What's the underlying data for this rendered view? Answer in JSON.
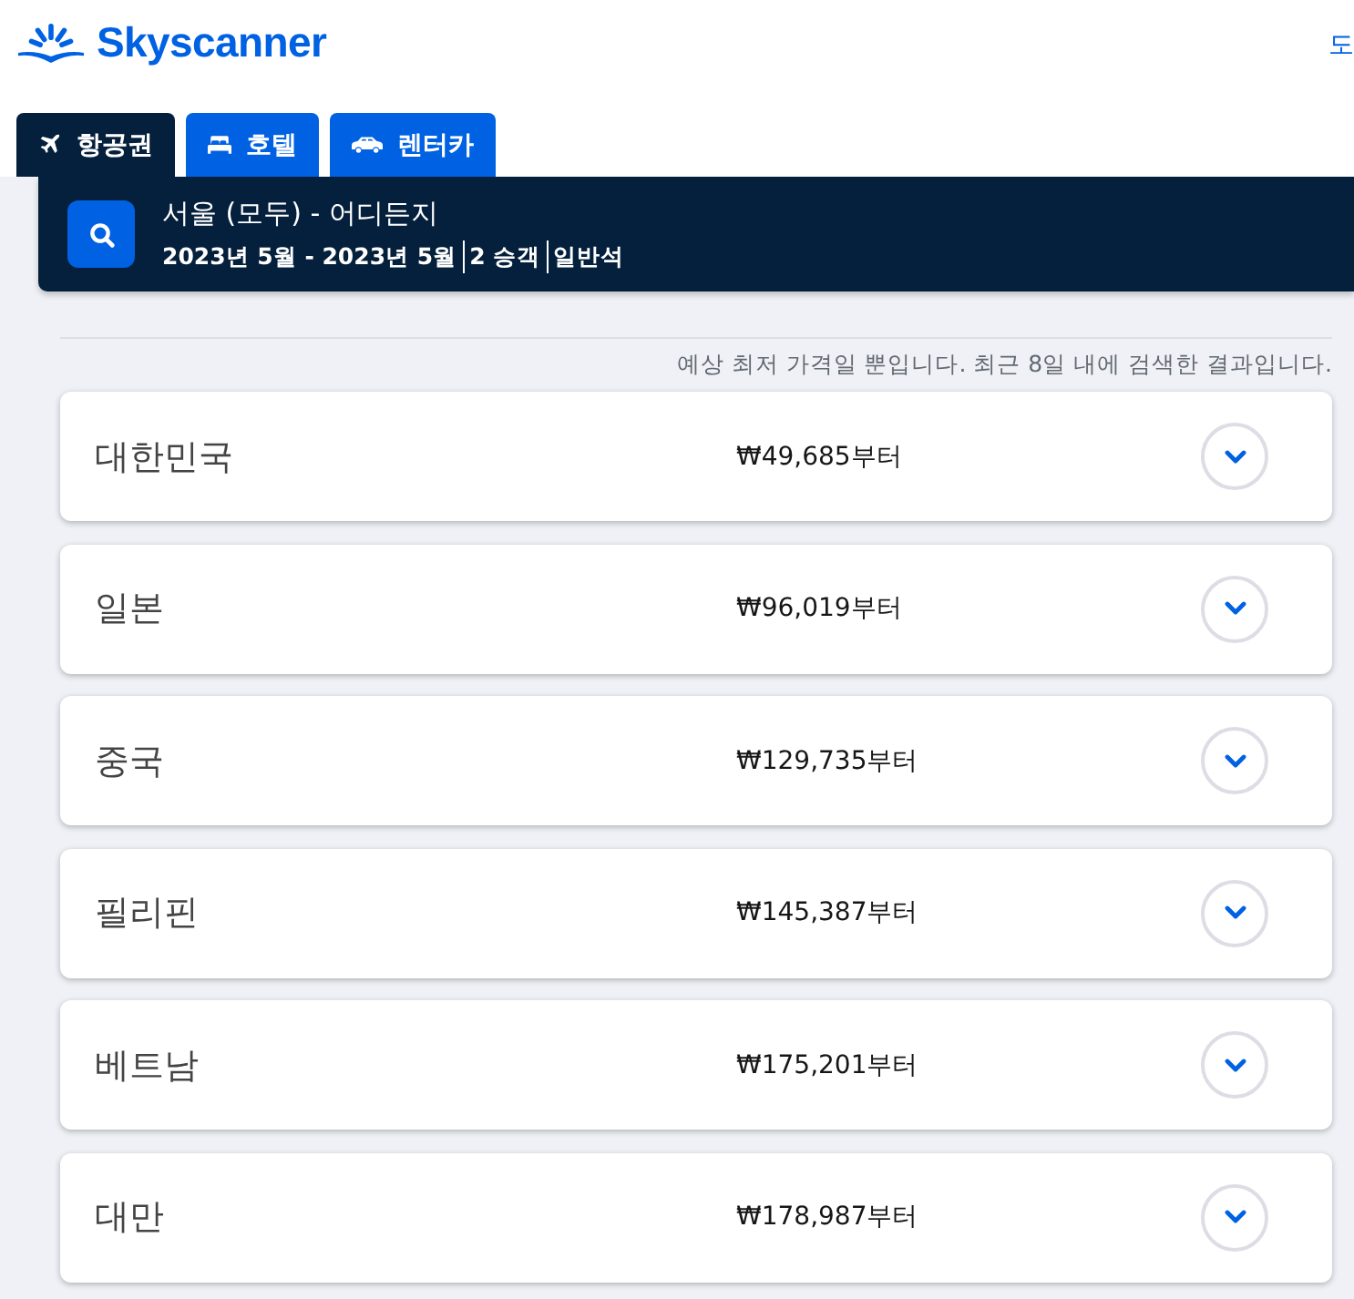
{
  "header": {
    "logo": "Skyscanner",
    "top_right_link": "도"
  },
  "tabs": [
    {
      "label": "항공권",
      "kind": "flights",
      "selected": true
    },
    {
      "label": "호텔",
      "kind": "hotels",
      "selected": false
    },
    {
      "label": "렌터카",
      "kind": "car",
      "selected": false
    }
  ],
  "search_summary": {
    "route": "서울 (모두) - 어디든지",
    "details": [
      "2023년 5월 - 2023년 5월",
      "2 승객",
      "일반석"
    ]
  },
  "note": "예상 최저 가격일 뿐입니다. 최근 8일 내에 검색한 결과입니다.",
  "results": [
    {
      "country": "대한민국",
      "price": "₩49,685부터",
      "expanded": false
    },
    {
      "country": "일본",
      "price": "₩96,019부터",
      "expanded": false
    },
    {
      "country": "중국",
      "price": "₩129,735부터",
      "expanded": false
    },
    {
      "country": "필리핀",
      "price": "₩145,387부터",
      "expanded": false
    },
    {
      "country": "베트남",
      "price": "₩175,201부터",
      "expanded": false
    },
    {
      "country": "대만",
      "price": "₩178,987부터",
      "expanded": false
    }
  ]
}
